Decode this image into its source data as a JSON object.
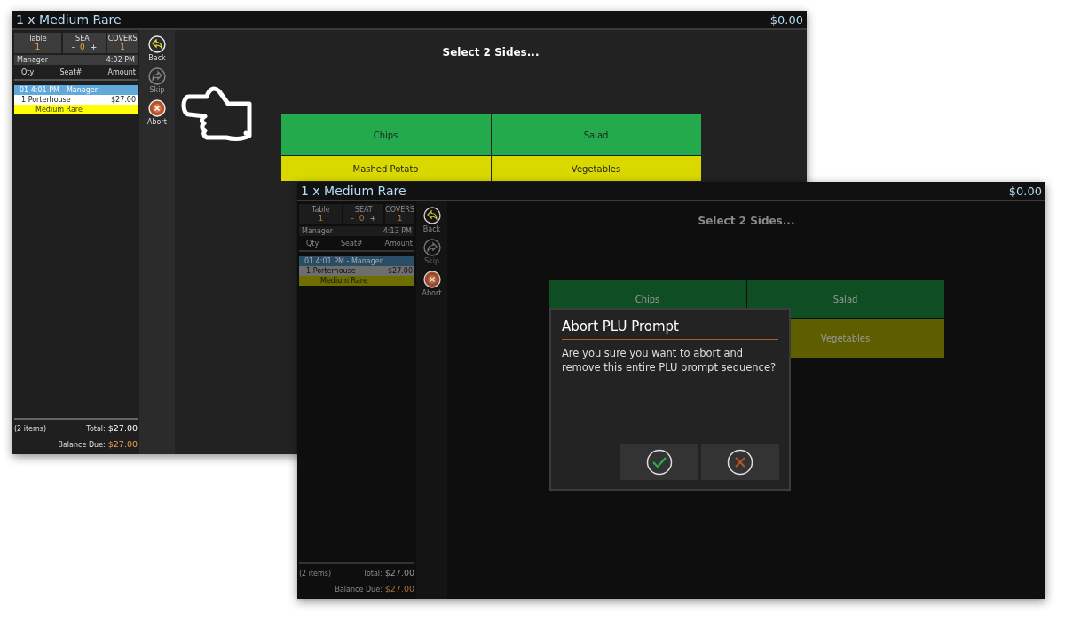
{
  "windows": [
    {
      "title": "1 x Medium Rare",
      "amount": "$0.00",
      "dimmed": false,
      "table": {
        "label": "Table",
        "value": "1"
      },
      "seat": {
        "label": "SEAT",
        "minus": "-",
        "value": "0",
        "plus": "+"
      },
      "covers": {
        "label": "COVERS",
        "value": "1"
      },
      "user": "Manager",
      "time": "4:02 PM",
      "columns": [
        "Qty",
        "Seat#",
        "Amount"
      ],
      "order_header": "01 4:01 PM - Manager",
      "items": [
        {
          "name": "1 Porterhouse",
          "amount": "$27.00",
          "modifiers": [
            "Medium Rare"
          ]
        }
      ],
      "item_count": "(2 items)",
      "total_label": "Total:",
      "total": "$27.00",
      "balance_label": "Balance Due:",
      "balance": "$27.00",
      "actions": [
        {
          "label": "Back",
          "kind": "back",
          "disabled": false
        },
        {
          "label": "Skip",
          "kind": "skip",
          "disabled": true
        },
        {
          "label": "Abort",
          "kind": "abort",
          "disabled": false
        }
      ],
      "prompt": "Select 2 Sides...",
      "options": [
        {
          "label": "Chips",
          "color": "#22aa4c"
        },
        {
          "label": "Salad",
          "color": "#22aa4c"
        },
        {
          "label": "Mashed Potato",
          "color": "#d9d900"
        },
        {
          "label": "Vegetables",
          "color": "#d9d900"
        }
      ]
    },
    {
      "title": "1 x Medium Rare",
      "amount": "$0.00",
      "dimmed": true,
      "table": {
        "label": "Table",
        "value": "1"
      },
      "seat": {
        "label": "SEAT",
        "minus": "-",
        "value": "0",
        "plus": "+"
      },
      "covers": {
        "label": "COVERS",
        "value": "1"
      },
      "user": "Manager",
      "time": "4:13 PM",
      "columns": [
        "Qty",
        "Seat#",
        "Amount"
      ],
      "order_header": "01 4:01 PM - Manager",
      "items": [
        {
          "name": "1 Porterhouse",
          "amount": "$27.00",
          "modifiers": [
            "Medium Rare"
          ]
        }
      ],
      "item_count": "(2 items)",
      "total_label": "Total:",
      "total": "$27.00",
      "balance_label": "Balance Due:",
      "balance": "$27.00",
      "actions": [
        {
          "label": "Back",
          "kind": "back",
          "disabled": false
        },
        {
          "label": "Skip",
          "kind": "skip",
          "disabled": true
        },
        {
          "label": "Abort",
          "kind": "abort",
          "disabled": false
        }
      ],
      "prompt": "Select 2 Sides...",
      "options": [
        {
          "label": "Chips",
          "color": "#0f4d22"
        },
        {
          "label": "Salad",
          "color": "#0f4d22"
        },
        {
          "label": "Vegetables",
          "color": "#5e5e00"
        }
      ],
      "dialog": {
        "title": "Abort PLU Prompt",
        "message": "Are you sure you want to abort and remove this entire PLU prompt sequence?",
        "buttons": [
          {
            "kind": "confirm"
          },
          {
            "kind": "cancel"
          }
        ]
      }
    }
  ]
}
